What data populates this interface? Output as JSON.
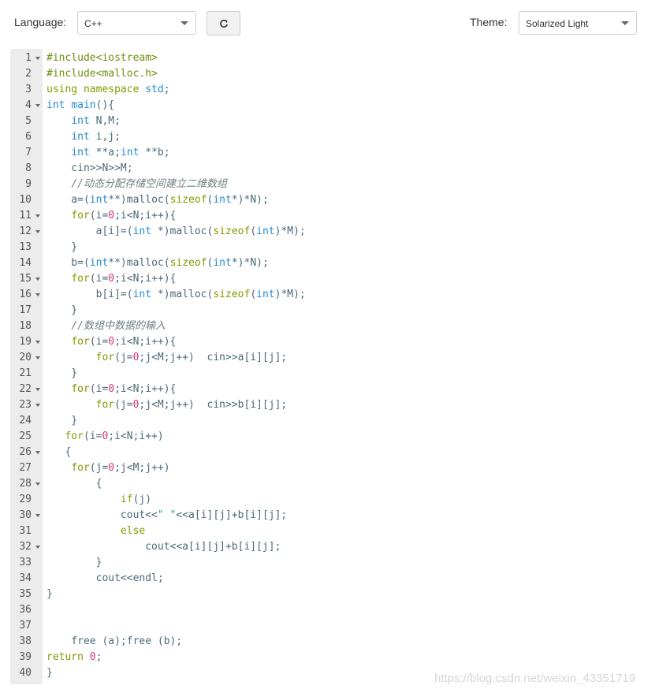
{
  "toolbar": {
    "language_label": "Language:",
    "language_value": "C++",
    "theme_label": "Theme:",
    "theme_value": "Solarized Light",
    "refresh_icon": "refresh-icon"
  },
  "colors": {
    "keyword": "#859900",
    "type": "#268bd2",
    "number": "#d33682",
    "string": "#2aa198",
    "preprocessor": "#6c8f0a",
    "comment": "#6e7f80",
    "text": "#586e75",
    "gutter_bg": "#ececec"
  },
  "editor": {
    "lines": [
      {
        "n": "1",
        "fold": true,
        "tokens": [
          {
            "t": "#include<iostream>",
            "c": "pp"
          }
        ]
      },
      {
        "n": "2",
        "fold": false,
        "tokens": [
          {
            "t": "#include<malloc.h>",
            "c": "pp"
          }
        ]
      },
      {
        "n": "3",
        "fold": false,
        "tokens": [
          {
            "t": "using",
            "c": "kw"
          },
          {
            "t": " "
          },
          {
            "t": "namespace",
            "c": "kw"
          },
          {
            "t": " "
          },
          {
            "t": "std",
            "c": "type"
          },
          {
            "t": ";"
          }
        ]
      },
      {
        "n": "4",
        "fold": true,
        "tokens": [
          {
            "t": "int",
            "c": "type"
          },
          {
            "t": " "
          },
          {
            "t": "main",
            "c": "type"
          },
          {
            "t": "(){"
          }
        ]
      },
      {
        "n": "5",
        "fold": false,
        "tokens": [
          {
            "t": "    "
          },
          {
            "t": "int",
            "c": "type"
          },
          {
            "t": " N,M;"
          }
        ]
      },
      {
        "n": "6",
        "fold": false,
        "tokens": [
          {
            "t": "    "
          },
          {
            "t": "int",
            "c": "type"
          },
          {
            "t": " i,j;"
          }
        ]
      },
      {
        "n": "7",
        "fold": false,
        "tokens": [
          {
            "t": "    "
          },
          {
            "t": "int",
            "c": "type"
          },
          {
            "t": " **a;"
          },
          {
            "t": "int",
            "c": "type"
          },
          {
            "t": " **b;"
          }
        ]
      },
      {
        "n": "8",
        "fold": false,
        "tokens": [
          {
            "t": "    cin>>N>>M;"
          }
        ]
      },
      {
        "n": "9",
        "fold": false,
        "tokens": [
          {
            "t": "    "
          },
          {
            "t": "//动态分配存储空间建立二维数组",
            "c": "cmt"
          }
        ]
      },
      {
        "n": "10",
        "fold": false,
        "tokens": [
          {
            "t": "    a=("
          },
          {
            "t": "int",
            "c": "type"
          },
          {
            "t": "**)malloc("
          },
          {
            "t": "sizeof",
            "c": "kw"
          },
          {
            "t": "("
          },
          {
            "t": "int",
            "c": "type"
          },
          {
            "t": "*)*N);"
          }
        ]
      },
      {
        "n": "11",
        "fold": true,
        "tokens": [
          {
            "t": "    "
          },
          {
            "t": "for",
            "c": "kw"
          },
          {
            "t": "(i="
          },
          {
            "t": "0",
            "c": "num"
          },
          {
            "t": ";i<N;i++){"
          }
        ]
      },
      {
        "n": "12",
        "fold": true,
        "tokens": [
          {
            "t": "        a[i]=("
          },
          {
            "t": "int",
            "c": "type"
          },
          {
            "t": " *)malloc("
          },
          {
            "t": "sizeof",
            "c": "kw"
          },
          {
            "t": "("
          },
          {
            "t": "int",
            "c": "type"
          },
          {
            "t": ")*M);"
          }
        ]
      },
      {
        "n": "13",
        "fold": false,
        "tokens": [
          {
            "t": "    }"
          }
        ]
      },
      {
        "n": "14",
        "fold": false,
        "tokens": [
          {
            "t": "    b=("
          },
          {
            "t": "int",
            "c": "type"
          },
          {
            "t": "**)malloc("
          },
          {
            "t": "sizeof",
            "c": "kw"
          },
          {
            "t": "("
          },
          {
            "t": "int",
            "c": "type"
          },
          {
            "t": "*)*N);"
          }
        ]
      },
      {
        "n": "15",
        "fold": true,
        "tokens": [
          {
            "t": "    "
          },
          {
            "t": "for",
            "c": "kw"
          },
          {
            "t": "(i="
          },
          {
            "t": "0",
            "c": "num"
          },
          {
            "t": ";i<N;i++){"
          }
        ]
      },
      {
        "n": "16",
        "fold": true,
        "tokens": [
          {
            "t": "        b[i]=("
          },
          {
            "t": "int",
            "c": "type"
          },
          {
            "t": " *)malloc("
          },
          {
            "t": "sizeof",
            "c": "kw"
          },
          {
            "t": "("
          },
          {
            "t": "int",
            "c": "type"
          },
          {
            "t": ")*M);"
          }
        ]
      },
      {
        "n": "17",
        "fold": false,
        "tokens": [
          {
            "t": "    }"
          }
        ]
      },
      {
        "n": "18",
        "fold": false,
        "tokens": [
          {
            "t": "    "
          },
          {
            "t": "//数组中数据的输入",
            "c": "cmt"
          }
        ]
      },
      {
        "n": "19",
        "fold": true,
        "tokens": [
          {
            "t": "    "
          },
          {
            "t": "for",
            "c": "kw"
          },
          {
            "t": "(i="
          },
          {
            "t": "0",
            "c": "num"
          },
          {
            "t": ";i<N;i++){"
          }
        ]
      },
      {
        "n": "20",
        "fold": true,
        "tokens": [
          {
            "t": "        "
          },
          {
            "t": "for",
            "c": "kw"
          },
          {
            "t": "(j="
          },
          {
            "t": "0",
            "c": "num"
          },
          {
            "t": ";j<M;j++)  cin>>a[i][j];"
          }
        ]
      },
      {
        "n": "21",
        "fold": false,
        "tokens": [
          {
            "t": "    }"
          }
        ]
      },
      {
        "n": "22",
        "fold": true,
        "tokens": [
          {
            "t": "    "
          },
          {
            "t": "for",
            "c": "kw"
          },
          {
            "t": "(i="
          },
          {
            "t": "0",
            "c": "num"
          },
          {
            "t": ";i<N;i++){"
          }
        ]
      },
      {
        "n": "23",
        "fold": true,
        "tokens": [
          {
            "t": "        "
          },
          {
            "t": "for",
            "c": "kw"
          },
          {
            "t": "(j="
          },
          {
            "t": "0",
            "c": "num"
          },
          {
            "t": ";j<M;j++)  cin>>b[i][j];"
          }
        ]
      },
      {
        "n": "24",
        "fold": false,
        "tokens": [
          {
            "t": "    }"
          }
        ]
      },
      {
        "n": "25",
        "fold": false,
        "tokens": [
          {
            "t": "   "
          },
          {
            "t": "for",
            "c": "kw"
          },
          {
            "t": "(i="
          },
          {
            "t": "0",
            "c": "num"
          },
          {
            "t": ";i<N;i++)"
          }
        ]
      },
      {
        "n": "26",
        "fold": true,
        "tokens": [
          {
            "t": "   {"
          }
        ]
      },
      {
        "n": "27",
        "fold": false,
        "tokens": [
          {
            "t": "    "
          },
          {
            "t": "for",
            "c": "kw"
          },
          {
            "t": "(j="
          },
          {
            "t": "0",
            "c": "num"
          },
          {
            "t": ";j<M;j++)"
          }
        ]
      },
      {
        "n": "28",
        "fold": true,
        "tokens": [
          {
            "t": "        {"
          }
        ]
      },
      {
        "n": "29",
        "fold": false,
        "tokens": [
          {
            "t": "            "
          },
          {
            "t": "if",
            "c": "kw"
          },
          {
            "t": "(j)"
          }
        ]
      },
      {
        "n": "30",
        "fold": true,
        "tokens": [
          {
            "t": "            cout<<"
          },
          {
            "t": "\" \"",
            "c": "str"
          },
          {
            "t": "<<a[i][j]+b[i][j];"
          }
        ]
      },
      {
        "n": "31",
        "fold": false,
        "tokens": [
          {
            "t": "            "
          },
          {
            "t": "else",
            "c": "kw"
          }
        ]
      },
      {
        "n": "32",
        "fold": true,
        "tokens": [
          {
            "t": "                cout<<a[i][j]+b[i][j];"
          }
        ]
      },
      {
        "n": "33",
        "fold": false,
        "tokens": [
          {
            "t": "        }"
          }
        ]
      },
      {
        "n": "34",
        "fold": false,
        "tokens": [
          {
            "t": "        cout<<endl;"
          }
        ]
      },
      {
        "n": "35",
        "fold": false,
        "tokens": [
          {
            "t": "}"
          }
        ]
      },
      {
        "n": "36",
        "fold": false,
        "tokens": []
      },
      {
        "n": "37",
        "fold": false,
        "tokens": []
      },
      {
        "n": "38",
        "fold": false,
        "tokens": [
          {
            "t": "    free (a);free (b);"
          }
        ]
      },
      {
        "n": "39",
        "fold": false,
        "tokens": [
          {
            "t": "return",
            "c": "kw"
          },
          {
            "t": " "
          },
          {
            "t": "0",
            "c": "num"
          },
          {
            "t": ";"
          }
        ]
      },
      {
        "n": "40",
        "fold": false,
        "tokens": [
          {
            "t": "}"
          }
        ]
      }
    ]
  },
  "watermark": "https://blog.csdn.net/weixin_43351719"
}
